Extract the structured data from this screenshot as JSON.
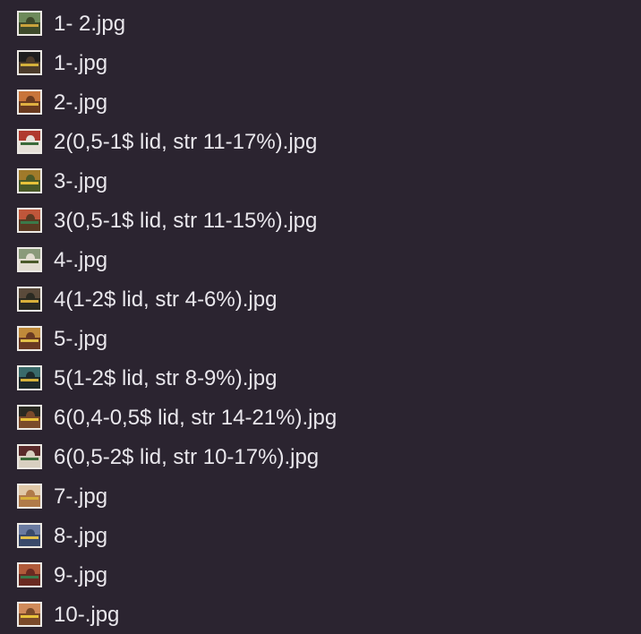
{
  "files": [
    {
      "name": "1- 2.jpg",
      "icon": "image-thumbnail-icon",
      "palette": [
        "#6d8a5a",
        "#3e4a2a",
        "#c9a23c"
      ]
    },
    {
      "name": "1-.jpg",
      "icon": "image-thumbnail-icon",
      "palette": [
        "#1e1e1e",
        "#4c3b2a",
        "#d4b13b"
      ]
    },
    {
      "name": "2-.jpg",
      "icon": "image-thumbnail-icon",
      "palette": [
        "#c8743a",
        "#6b3b1f",
        "#e0b040"
      ]
    },
    {
      "name": "2(0,5-1$ lid, str 11-17%).jpg",
      "icon": "image-thumbnail-icon",
      "palette": [
        "#b03a2e",
        "#e6e0d8",
        "#3a6a3a"
      ]
    },
    {
      "name": "3-.jpg",
      "icon": "image-thumbnail-icon",
      "palette": [
        "#a07a2a",
        "#4a5a28",
        "#e8c23a"
      ]
    },
    {
      "name": "3(0,5-1$ lid, str 11-15%).jpg",
      "icon": "image-thumbnail-icon",
      "palette": [
        "#c0563a",
        "#5a3a22",
        "#3a7a4a"
      ]
    },
    {
      "name": "4-.jpg",
      "icon": "image-thumbnail-icon",
      "palette": [
        "#8a9a7a",
        "#e2ddd0",
        "#4a5a2a"
      ]
    },
    {
      "name": "4(1-2$ lid, str 4-6%).jpg",
      "icon": "image-thumbnail-icon",
      "palette": [
        "#5a4a3a",
        "#2a2a22",
        "#d8b03a"
      ]
    },
    {
      "name": "5-.jpg",
      "icon": "image-thumbnail-icon",
      "palette": [
        "#c08a3a",
        "#6a3a22",
        "#e2c048"
      ]
    },
    {
      "name": "5(1-2$ lid, str 8-9%).jpg",
      "icon": "image-thumbnail-icon",
      "palette": [
        "#3a6a6a",
        "#1e2a2a",
        "#d4b13b"
      ]
    },
    {
      "name": "6(0,4-0,5$ lid, str 14-21%).jpg",
      "icon": "image-thumbnail-icon",
      "palette": [
        "#2a2a22",
        "#7a4a2a",
        "#e8c23a"
      ]
    },
    {
      "name": "6(0,5-2$ lid, str 10-17%).jpg",
      "icon": "image-thumbnail-icon",
      "palette": [
        "#5a2a2a",
        "#d8cfc0",
        "#3a6a3a"
      ]
    },
    {
      "name": "7-.jpg",
      "icon": "image-thumbnail-icon",
      "palette": [
        "#e0c8a8",
        "#b07a4a",
        "#d8b03a"
      ]
    },
    {
      "name": "8-.jpg",
      "icon": "image-thumbnail-icon",
      "palette": [
        "#6a7aa0",
        "#3a4a6a",
        "#e2c048"
      ]
    },
    {
      "name": "9-.jpg",
      "icon": "image-thumbnail-icon",
      "palette": [
        "#b05a3a",
        "#6a2a22",
        "#3a7a4a"
      ]
    },
    {
      "name": "10-.jpg",
      "icon": "image-thumbnail-icon",
      "palette": [
        "#d08a5a",
        "#7a4a2a",
        "#e8c23a"
      ]
    }
  ]
}
